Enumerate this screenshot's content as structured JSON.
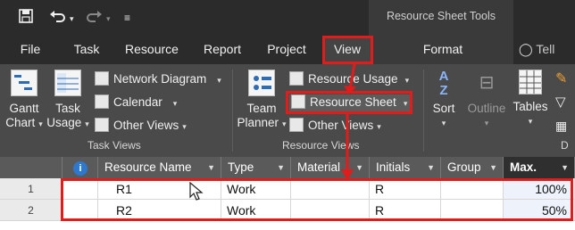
{
  "qat": {
    "save_icon": "save-icon",
    "undo_icon": "undo-icon",
    "redo_icon": "redo-icon",
    "customize_icon": "customize-qat-icon"
  },
  "context_tab": "Resource Sheet Tools",
  "tabs": [
    {
      "label": "File"
    },
    {
      "label": "Task"
    },
    {
      "label": "Resource"
    },
    {
      "label": "Report"
    },
    {
      "label": "Project"
    },
    {
      "label": "View"
    },
    {
      "label": "Format"
    }
  ],
  "tell_me": "Tell me",
  "ribbon": {
    "task_views": {
      "gantt": [
        "Gantt",
        "Chart"
      ],
      "task_usage": [
        "Task",
        "Usage"
      ],
      "network_diagram": "Network Diagram",
      "calendar": "Calendar",
      "other_views": "Other Views",
      "label": "Task Views"
    },
    "resource_views": {
      "team_planner": [
        "Team",
        "Planner"
      ],
      "resource_usage": "Resource Usage",
      "resource_sheet": "Resource Sheet",
      "other_views": "Other Views",
      "label": "Resource Views"
    },
    "data": {
      "sort": "Sort",
      "outline": "Outline",
      "tables": "Tables",
      "label_partial": "D"
    }
  },
  "grid": {
    "headers": [
      "Resource Name",
      "Type",
      "Material",
      "Initials",
      "Group",
      "Max."
    ],
    "rows": [
      {
        "num": "1",
        "name": "R1",
        "type": "Work",
        "material": "",
        "initials": "R",
        "group": "",
        "max": "100%"
      },
      {
        "num": "2",
        "name": "R2",
        "type": "Work",
        "material": "",
        "initials": "R",
        "group": "",
        "max": "50%"
      }
    ]
  },
  "colors": {
    "annotation": "#e21b1b",
    "ribbon_bg": "#4a4a4a",
    "title_bg": "#2b2b2b"
  }
}
